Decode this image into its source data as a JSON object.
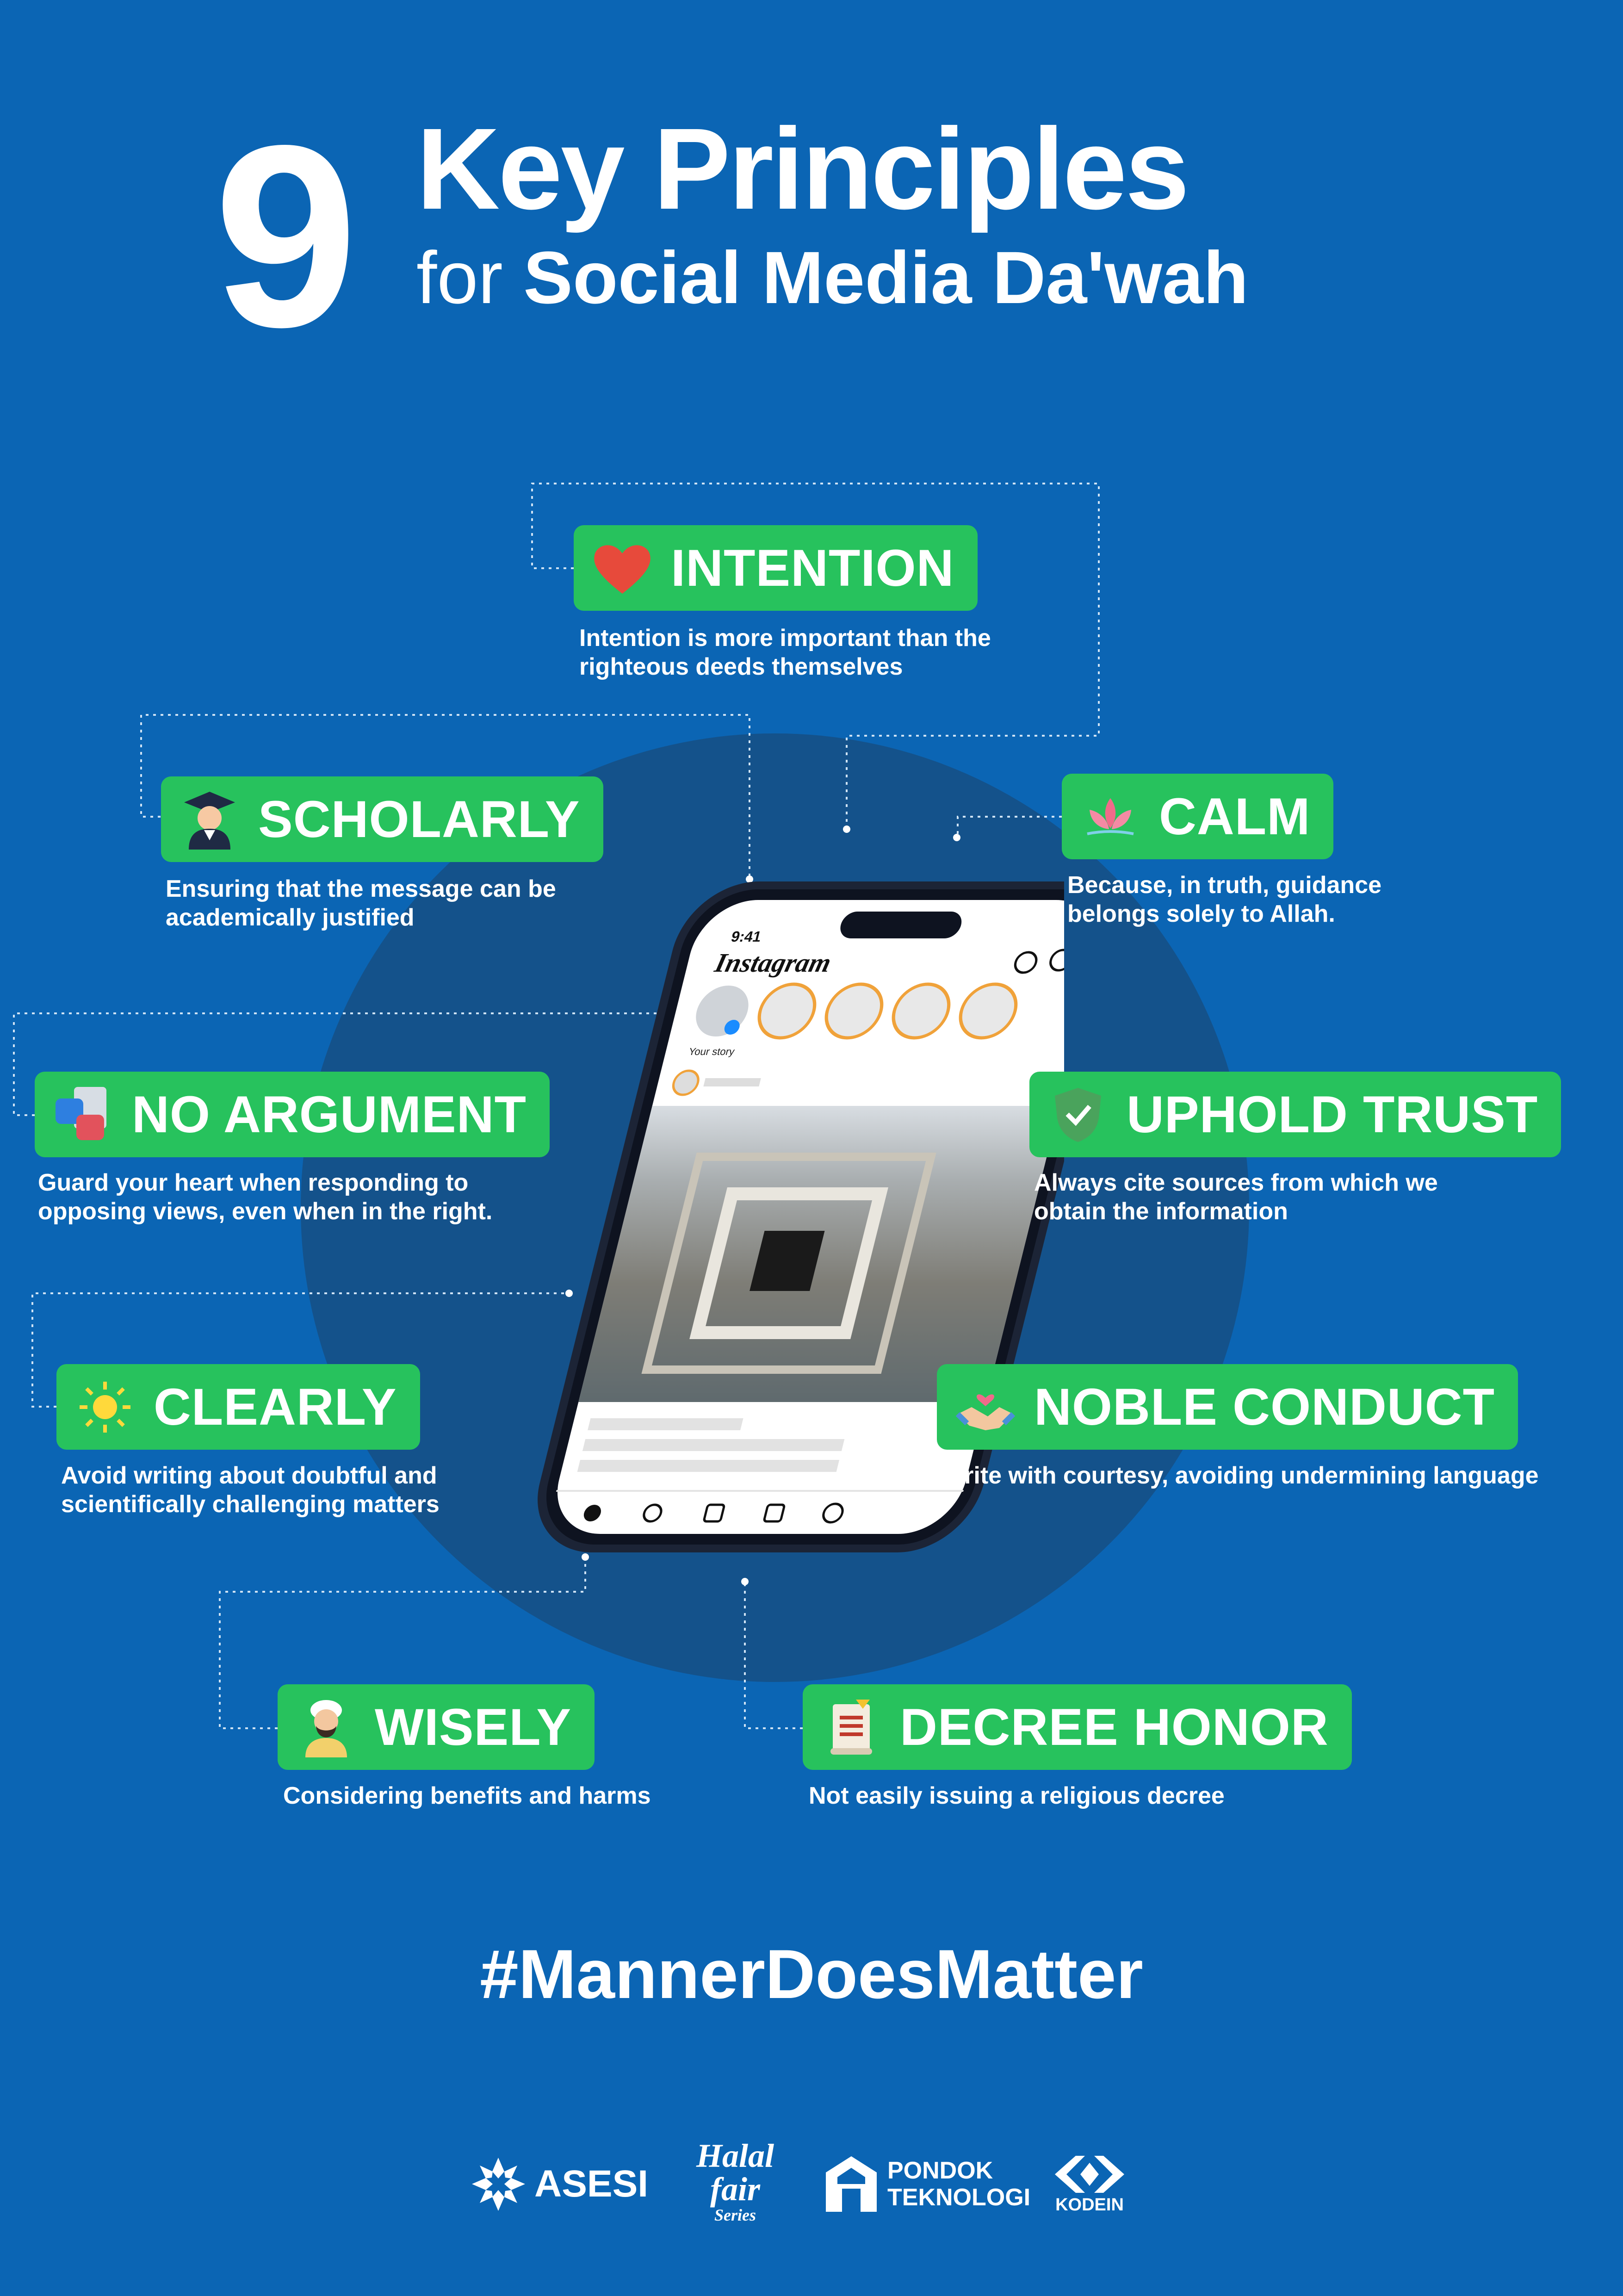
{
  "header": {
    "number": "9",
    "title": "Key Principles",
    "subtitle_light": "for",
    "subtitle_bold": "Social Media Da'wah"
  },
  "phone": {
    "time": "9:41",
    "app_name": "Instagram",
    "your_story_label": "Your story"
  },
  "principles": [
    {
      "label": "INTENTION",
      "icon": "heart-icon",
      "desc1": "Intention is more important than the",
      "desc2": "righteous deeds themselves"
    },
    {
      "label": "SCHOLARLY",
      "icon": "graduate-icon",
      "desc1": "Ensuring that the message can be",
      "desc2": "academically justified"
    },
    {
      "label": "CALM",
      "icon": "lotus-icon",
      "desc1": "Because, in truth, guidance",
      "desc2": "belongs solely to Allah."
    },
    {
      "label": "NO ARGUMENT",
      "icon": "debate-icon",
      "desc1": "Guard your heart when responding to",
      "desc2": "opposing views, even when in the right."
    },
    {
      "label": "UPHOLD TRUST",
      "icon": "shield-icon",
      "desc1": "Always cite sources from which we",
      "desc2": "obtain the information"
    },
    {
      "label": "CLEARLY",
      "icon": "sun-icon",
      "desc1": "Avoid writing about doubtful and",
      "desc2": "scientifically challenging matters"
    },
    {
      "label": "NOBLE CONDUCT",
      "icon": "handshake-icon",
      "desc1": "Write with courtesy, avoiding undermining language",
      "desc2": ""
    },
    {
      "label": "WISELY",
      "icon": "elder-icon",
      "desc1": "Considering benefits and harms",
      "desc2": ""
    },
    {
      "label": "DECREE HONOR",
      "icon": "scroll-icon",
      "desc1": "Not easily issuing a religious decree",
      "desc2": ""
    }
  ],
  "hashtag": "#MannerDoesMatter",
  "logos": {
    "asesi": "ASESI",
    "halal": "Halal",
    "fair": "fair",
    "series": "Series",
    "pondok1": "PONDOK",
    "pondok2": "TEKNOLOGI",
    "kodein": "KODEIN"
  },
  "colors": {
    "background": "#0b65b4",
    "pill": "#27c25d",
    "disk": "#14528b"
  }
}
